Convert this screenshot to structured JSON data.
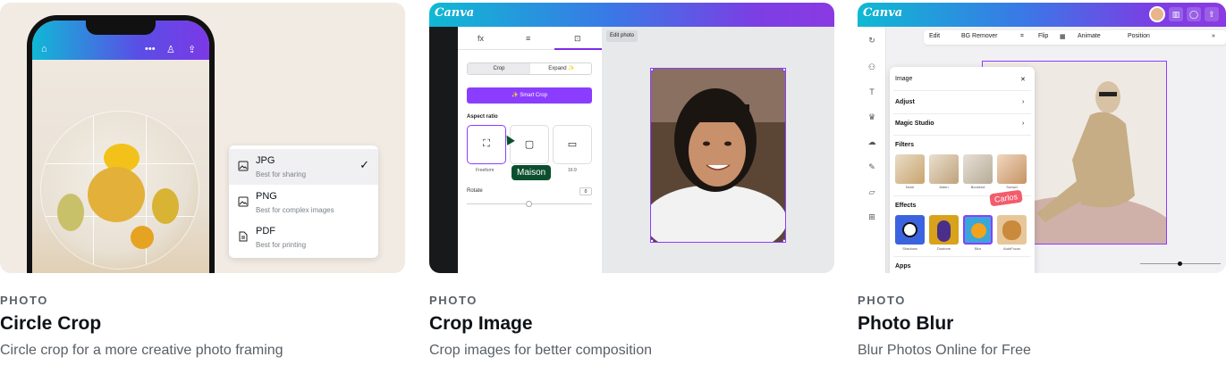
{
  "cards": [
    {
      "category": "PHOTO",
      "title": "Circle Crop",
      "description": "Circle crop for a more creative photo framing",
      "dropdown": [
        {
          "label": "JPG",
          "sub": "Best for sharing",
          "selected": true
        },
        {
          "label": "PNG",
          "sub": "Best for complex images",
          "selected": false
        },
        {
          "label": "PDF",
          "sub": "Best for printing",
          "selected": false
        }
      ],
      "check_glyph": "✓"
    },
    {
      "category": "PHOTO",
      "title": "Crop Image",
      "description": "Crop images for better composition",
      "logo": "Canva",
      "tabs": [
        "fx",
        "≡",
        "⊡"
      ],
      "seg_a": "Crop",
      "seg_b": "Expand ✨",
      "smart_crop": "✨ Smart Crop",
      "aspect_label": "Aspect ratio",
      "aspect_caption": "Freeform",
      "aspect_caption_2": "16:9",
      "rotate_label": "Rotate",
      "rotate_value": "0",
      "cursor_name": "Maison",
      "edit_chip": "Edit photo"
    },
    {
      "category": "PHOTO",
      "title": "Photo Blur",
      "description": "Blur Photos Online for Free",
      "logo": "Canva",
      "toolbar": [
        "Edit",
        "BG Remover",
        "Flip",
        "Animate",
        "Position"
      ],
      "panel_title": "Image",
      "adjust": "Adjust",
      "magic": "Magic Studio",
      "filters_label": "Filters",
      "filters": [
        "None",
        "Aiden",
        "Bookend",
        "Sunset"
      ],
      "effects_label": "Effects",
      "effects": [
        "Shadows",
        "Duotone",
        "Blur",
        "AutoFocus"
      ],
      "apps_label": "Apps",
      "cursor_name": "Carlos"
    }
  ],
  "colors": {
    "accent": "#8b3dff",
    "maison_tag": "#0b4f2f",
    "carlos_tag": "#f25c6b"
  }
}
